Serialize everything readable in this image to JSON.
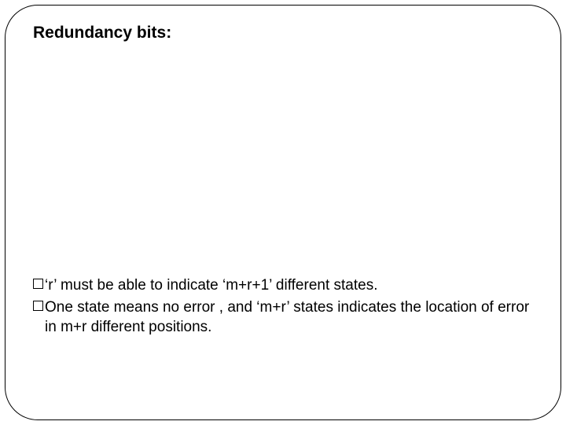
{
  "title": "Redundancy bits:",
  "bullets": [
    {
      "text": "‘r’ must be able to indicate ‘m+r+1’ different states."
    },
    {
      "text": "One state means no error , and  ‘m+r’ states indicates the location of error in m+r different positions."
    }
  ]
}
